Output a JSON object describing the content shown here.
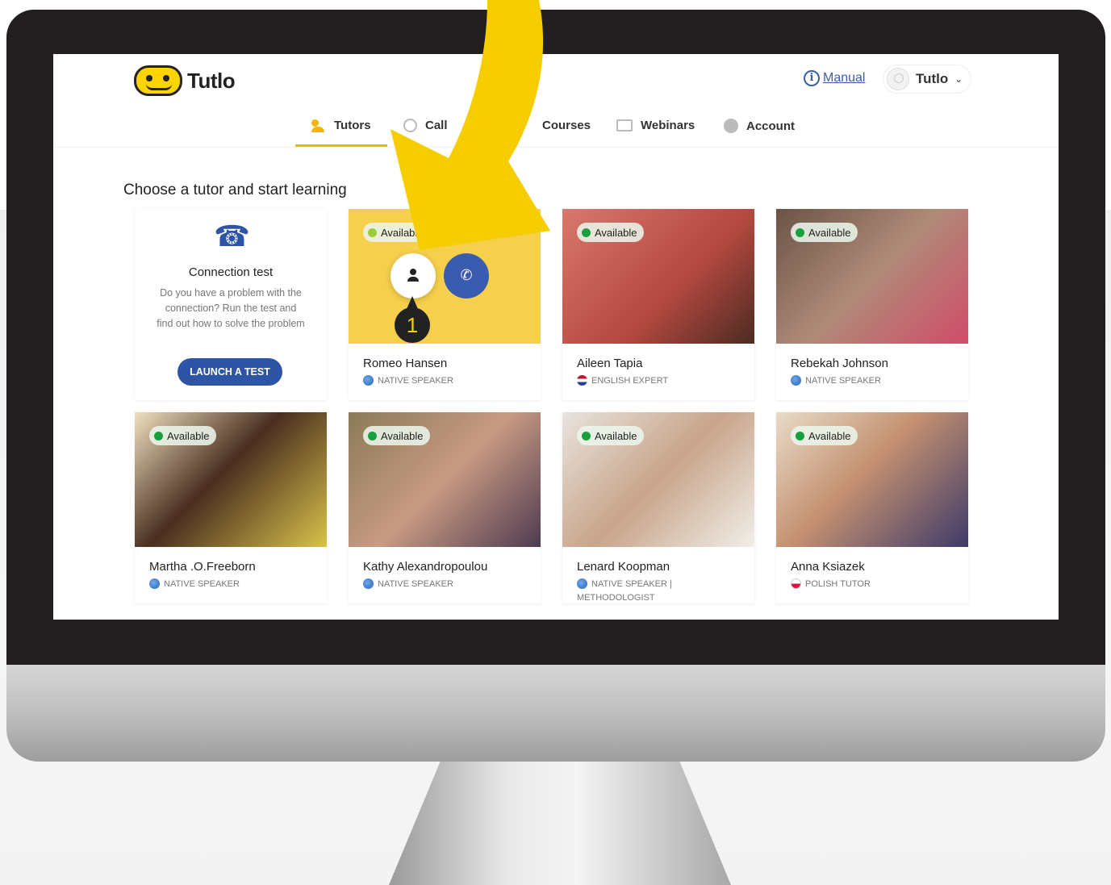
{
  "app": {
    "logo_text": "Tutlo",
    "manual_label": "Manual",
    "user_name": "Tutlo"
  },
  "nav": {
    "items": [
      {
        "label": "Tutors",
        "icon": "tutors-icon"
      },
      {
        "label": "Call",
        "icon": "clock-icon"
      },
      {
        "label": "Courses",
        "icon": "courses-icon"
      },
      {
        "label": "Webinars",
        "icon": "webinars-icon"
      },
      {
        "label": "Account",
        "icon": "account-icon"
      }
    ]
  },
  "main": {
    "heading": "Choose a tutor and start learning",
    "connection_test": {
      "title": "Connection test",
      "text": "Do you have a problem with the connection? Run the test and find out how to solve the problem",
      "button_label": "LAUNCH A TEST"
    },
    "available_label": "Available",
    "step_marker": "1",
    "tutors": [
      {
        "name": "Romeo Hansen",
        "role": "NATIVE SPEAKER",
        "flag": "globe",
        "status": "Available",
        "hovered": true,
        "photo_color": "#f6cf4c"
      },
      {
        "name": "Aileen Tapia",
        "role": "ENGLISH EXPERT",
        "flag": "us",
        "status": "Available",
        "photo_color": "#c9675d"
      },
      {
        "name": "Rebekah Johnson",
        "role": "NATIVE SPEAKER",
        "flag": "globe",
        "status": "Available",
        "photo_color": "#8c6a58"
      },
      {
        "name": "Martha .O.Freeborn",
        "role": "NATIVE SPEAKER",
        "flag": "globe",
        "status": "Available",
        "photo_color": "#5a3a28"
      },
      {
        "name": "Kathy Alexandropoulou",
        "role": "NATIVE SPEAKER",
        "flag": "globe",
        "status": "Available",
        "photo_color": "#7a6a4e"
      },
      {
        "name": "Lenard Koopman",
        "role": "NATIVE SPEAKER |",
        "role2": "METHODOLOGIST",
        "flag": "globe",
        "status": "Available",
        "photo_color": "#b8b1a6"
      },
      {
        "name": "Anna Ksiazek",
        "role": "POLISH TUTOR",
        "flag": "pl",
        "status": "Available",
        "photo_color": "#a07a60"
      }
    ]
  },
  "colors": {
    "accent_yellow": "#f4b400",
    "brand_blue": "#2e55a5",
    "available_green": "#18a03f",
    "bezel": "#231f20",
    "arrow_yellow": "#f6cd00"
  }
}
